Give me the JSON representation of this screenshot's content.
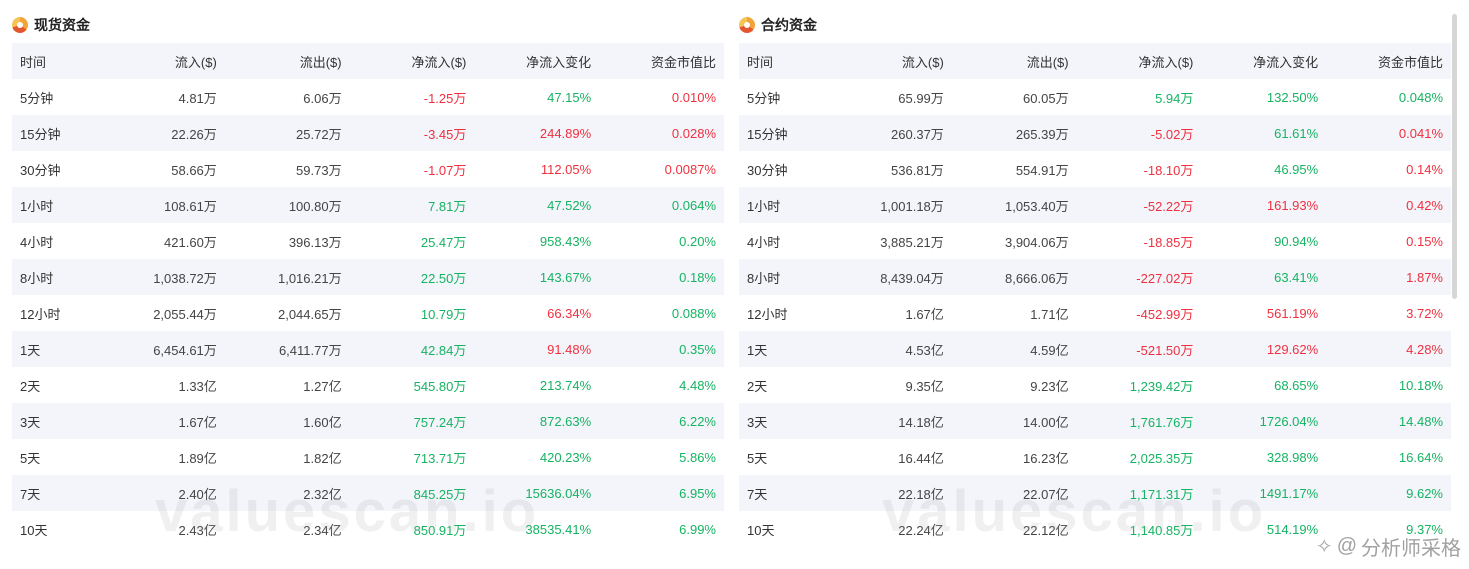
{
  "panels": [
    {
      "title": "现货资金",
      "columns": [
        "时间",
        "流入($)",
        "流出($)",
        "净流入($)",
        "净流入变化",
        "资金市值比"
      ],
      "rows": [
        {
          "time": "5分钟",
          "inflow": "4.81万",
          "outflow": "6.06万",
          "net": "-1.25万",
          "change": "47.15%",
          "ratio": "0.010%",
          "net_dir": "neg",
          "change_dir": "pos",
          "ratio_dir": "neg"
        },
        {
          "time": "15分钟",
          "inflow": "22.26万",
          "outflow": "25.72万",
          "net": "-3.45万",
          "change": "244.89%",
          "ratio": "0.028%",
          "net_dir": "neg",
          "change_dir": "neg",
          "ratio_dir": "neg"
        },
        {
          "time": "30分钟",
          "inflow": "58.66万",
          "outflow": "59.73万",
          "net": "-1.07万",
          "change": "112.05%",
          "ratio": "0.0087%",
          "net_dir": "neg",
          "change_dir": "neg",
          "ratio_dir": "neg"
        },
        {
          "time": "1小时",
          "inflow": "108.61万",
          "outflow": "100.80万",
          "net": "7.81万",
          "change": "47.52%",
          "ratio": "0.064%",
          "net_dir": "pos",
          "change_dir": "pos",
          "ratio_dir": "pos"
        },
        {
          "time": "4小时",
          "inflow": "421.60万",
          "outflow": "396.13万",
          "net": "25.47万",
          "change": "958.43%",
          "ratio": "0.20%",
          "net_dir": "pos",
          "change_dir": "pos",
          "ratio_dir": "pos"
        },
        {
          "time": "8小时",
          "inflow": "1,038.72万",
          "outflow": "1,016.21万",
          "net": "22.50万",
          "change": "143.67%",
          "ratio": "0.18%",
          "net_dir": "pos",
          "change_dir": "pos",
          "ratio_dir": "pos"
        },
        {
          "time": "12小时",
          "inflow": "2,055.44万",
          "outflow": "2,044.65万",
          "net": "10.79万",
          "change": "66.34%",
          "ratio": "0.088%",
          "net_dir": "pos",
          "change_dir": "neg",
          "ratio_dir": "pos"
        },
        {
          "time": "1天",
          "inflow": "6,454.61万",
          "outflow": "6,411.77万",
          "net": "42.84万",
          "change": "91.48%",
          "ratio": "0.35%",
          "net_dir": "pos",
          "change_dir": "neg",
          "ratio_dir": "pos"
        },
        {
          "time": "2天",
          "inflow": "1.33亿",
          "outflow": "1.27亿",
          "net": "545.80万",
          "change": "213.74%",
          "ratio": "4.48%",
          "net_dir": "pos",
          "change_dir": "pos",
          "ratio_dir": "pos"
        },
        {
          "time": "3天",
          "inflow": "1.67亿",
          "outflow": "1.60亿",
          "net": "757.24万",
          "change": "872.63%",
          "ratio": "6.22%",
          "net_dir": "pos",
          "change_dir": "pos",
          "ratio_dir": "pos"
        },
        {
          "time": "5天",
          "inflow": "1.89亿",
          "outflow": "1.82亿",
          "net": "713.71万",
          "change": "420.23%",
          "ratio": "5.86%",
          "net_dir": "pos",
          "change_dir": "pos",
          "ratio_dir": "pos"
        },
        {
          "time": "7天",
          "inflow": "2.40亿",
          "outflow": "2.32亿",
          "net": "845.25万",
          "change": "15636.04%",
          "ratio": "6.95%",
          "net_dir": "pos",
          "change_dir": "pos",
          "ratio_dir": "pos"
        },
        {
          "time": "10天",
          "inflow": "2.43亿",
          "outflow": "2.34亿",
          "net": "850.91万",
          "change": "38535.41%",
          "ratio": "6.99%",
          "net_dir": "pos",
          "change_dir": "pos",
          "ratio_dir": "pos"
        }
      ]
    },
    {
      "title": "合约资金",
      "columns": [
        "时间",
        "流入($)",
        "流出($)",
        "净流入($)",
        "净流入变化",
        "资金市值比"
      ],
      "rows": [
        {
          "time": "5分钟",
          "inflow": "65.99万",
          "outflow": "60.05万",
          "net": "5.94万",
          "change": "132.50%",
          "ratio": "0.048%",
          "net_dir": "pos",
          "change_dir": "pos",
          "ratio_dir": "pos"
        },
        {
          "time": "15分钟",
          "inflow": "260.37万",
          "outflow": "265.39万",
          "net": "-5.02万",
          "change": "61.61%",
          "ratio": "0.041%",
          "net_dir": "neg",
          "change_dir": "pos",
          "ratio_dir": "neg"
        },
        {
          "time": "30分钟",
          "inflow": "536.81万",
          "outflow": "554.91万",
          "net": "-18.10万",
          "change": "46.95%",
          "ratio": "0.14%",
          "net_dir": "neg",
          "change_dir": "pos",
          "ratio_dir": "neg"
        },
        {
          "time": "1小时",
          "inflow": "1,001.18万",
          "outflow": "1,053.40万",
          "net": "-52.22万",
          "change": "161.93%",
          "ratio": "0.42%",
          "net_dir": "neg",
          "change_dir": "neg",
          "ratio_dir": "neg"
        },
        {
          "time": "4小时",
          "inflow": "3,885.21万",
          "outflow": "3,904.06万",
          "net": "-18.85万",
          "change": "90.94%",
          "ratio": "0.15%",
          "net_dir": "neg",
          "change_dir": "pos",
          "ratio_dir": "neg"
        },
        {
          "time": "8小时",
          "inflow": "8,439.04万",
          "outflow": "8,666.06万",
          "net": "-227.02万",
          "change": "63.41%",
          "ratio": "1.87%",
          "net_dir": "neg",
          "change_dir": "pos",
          "ratio_dir": "neg"
        },
        {
          "time": "12小时",
          "inflow": "1.67亿",
          "outflow": "1.71亿",
          "net": "-452.99万",
          "change": "561.19%",
          "ratio": "3.72%",
          "net_dir": "neg",
          "change_dir": "neg",
          "ratio_dir": "neg"
        },
        {
          "time": "1天",
          "inflow": "4.53亿",
          "outflow": "4.59亿",
          "net": "-521.50万",
          "change": "129.62%",
          "ratio": "4.28%",
          "net_dir": "neg",
          "change_dir": "neg",
          "ratio_dir": "neg"
        },
        {
          "time": "2天",
          "inflow": "9.35亿",
          "outflow": "9.23亿",
          "net": "1,239.42万",
          "change": "68.65%",
          "ratio": "10.18%",
          "net_dir": "pos",
          "change_dir": "pos",
          "ratio_dir": "pos"
        },
        {
          "time": "3天",
          "inflow": "14.18亿",
          "outflow": "14.00亿",
          "net": "1,761.76万",
          "change": "1726.04%",
          "ratio": "14.48%",
          "net_dir": "pos",
          "change_dir": "pos",
          "ratio_dir": "pos"
        },
        {
          "time": "5天",
          "inflow": "16.44亿",
          "outflow": "16.23亿",
          "net": "2,025.35万",
          "change": "328.98%",
          "ratio": "16.64%",
          "net_dir": "pos",
          "change_dir": "pos",
          "ratio_dir": "pos"
        },
        {
          "time": "7天",
          "inflow": "22.18亿",
          "outflow": "22.07亿",
          "net": "1,171.31万",
          "change": "1491.17%",
          "ratio": "9.62%",
          "net_dir": "pos",
          "change_dir": "pos",
          "ratio_dir": "pos"
        },
        {
          "time": "10天",
          "inflow": "22.24亿",
          "outflow": "22.12亿",
          "net": "1,140.85万",
          "change": "514.19%",
          "ratio": "9.37%",
          "net_dir": "pos",
          "change_dir": "pos",
          "ratio_dir": "pos"
        }
      ]
    }
  ],
  "watermark": "valuescan.io",
  "signature": "分析师采格",
  "colors": {
    "positive": "#16b362",
    "negative": "#f0303f",
    "stripe": "#f3f5fa"
  },
  "icons": {
    "panel_logo": "pie-logo-icon",
    "signature": "diamond-icon"
  }
}
